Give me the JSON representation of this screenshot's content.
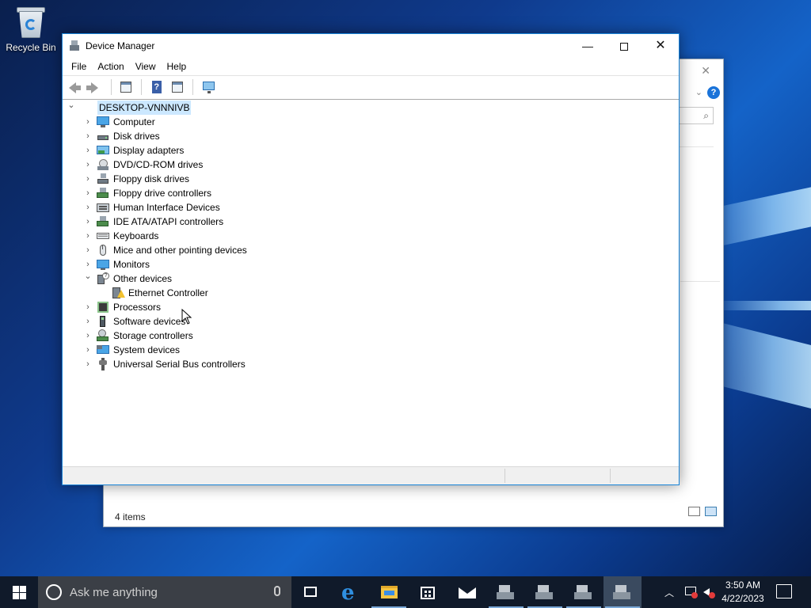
{
  "desktop": {
    "recycle_bin_label": "Recycle Bin"
  },
  "background_window": {
    "status_text": "4 items",
    "help_glyph": "?"
  },
  "window": {
    "title": "Device Manager",
    "controls": {
      "minimize": "—",
      "close": "✕"
    },
    "menu": [
      "File",
      "Action",
      "View",
      "Help"
    ],
    "toolbar": [
      "back-icon",
      "forward-icon",
      "properties-sheet-icon",
      "help-icon",
      "view-sheet-icon",
      "monitor-icon"
    ]
  },
  "tree": {
    "root": "DESKTOP-VNNNIVB",
    "items": [
      {
        "label": "Computer",
        "icon": "computer-icon",
        "expanded": false
      },
      {
        "label": "Disk drives",
        "icon": "disk-drive-icon",
        "expanded": false
      },
      {
        "label": "Display adapters",
        "icon": "display-adapter-icon",
        "expanded": false
      },
      {
        "label": "DVD/CD-ROM drives",
        "icon": "dvd-drive-icon",
        "expanded": false
      },
      {
        "label": "Floppy disk drives",
        "icon": "floppy-disk-icon",
        "expanded": false
      },
      {
        "label": "Floppy drive controllers",
        "icon": "floppy-controller-icon",
        "expanded": false
      },
      {
        "label": "Human Interface Devices",
        "icon": "hid-icon",
        "expanded": false
      },
      {
        "label": "IDE ATA/ATAPI controllers",
        "icon": "ide-controller-icon",
        "expanded": false
      },
      {
        "label": "Keyboards",
        "icon": "keyboard-icon",
        "expanded": false
      },
      {
        "label": "Mice and other pointing devices",
        "icon": "mouse-icon",
        "expanded": false
      },
      {
        "label": "Monitors",
        "icon": "monitor-icon",
        "expanded": false
      },
      {
        "label": "Other devices",
        "icon": "unknown-device-icon",
        "expanded": true
      },
      {
        "label": "Ethernet Controller",
        "icon": "warning-device-icon",
        "child": true
      },
      {
        "label": "Processors",
        "icon": "processor-icon",
        "expanded": false
      },
      {
        "label": "Software devices",
        "icon": "software-device-icon",
        "expanded": false
      },
      {
        "label": "Storage controllers",
        "icon": "storage-controller-icon",
        "expanded": false
      },
      {
        "label": "System devices",
        "icon": "system-devices-icon",
        "expanded": false
      },
      {
        "label": "Universal Serial Bus controllers",
        "icon": "usb-icon",
        "expanded": false
      }
    ]
  },
  "taskbar": {
    "search_placeholder": "Ask me anything",
    "apps": [
      "task-view-icon",
      "edge-icon",
      "file-explorer-icon",
      "store-icon",
      "mail-icon",
      "device-manager-icon",
      "device-manager-icon",
      "device-manager-icon",
      "device-manager-icon"
    ],
    "clock_time": "3:50 AM",
    "clock_date": "4/22/2023"
  },
  "colors": {
    "accent": "#1883d7",
    "selection": "#cce8ff",
    "taskbar": "#101a2a"
  }
}
